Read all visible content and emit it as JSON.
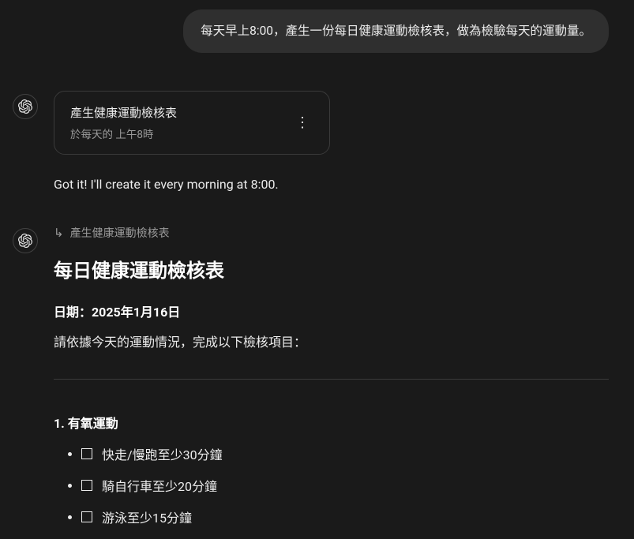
{
  "user_message": "每天早上8:00，產生一份每日健康運動檢核表，做為檢驗每天的運動量。",
  "task_card": {
    "title": "產生健康運動檢核表",
    "subtitle": "於每天的 上午8時"
  },
  "confirm": "Got it! I'll create it every morning at 8:00.",
  "reply_header": "產生健康運動檢核表",
  "doc": {
    "title": "每日健康運動檢核表",
    "date": "日期：2025年1月16日",
    "instructions": "請依據今天的運動情況，完成以下檢核項目：",
    "section1": {
      "title": "1. 有氧運動",
      "items": [
        "快走/慢跑至少30分鐘",
        "騎自行車至少20分鐘",
        "游泳至少15分鐘"
      ]
    }
  }
}
